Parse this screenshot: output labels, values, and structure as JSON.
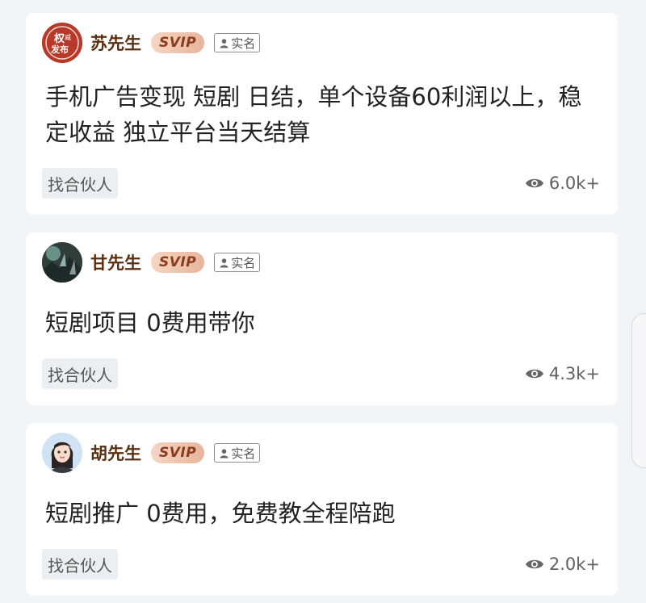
{
  "posts": [
    {
      "author": "苏先生",
      "badge": "SVIP",
      "verified": "实名",
      "avatar_icon": "official-release-seal-icon",
      "avatar_text": "权威发布",
      "title": "手机广告变现 短剧 日结，单个设备60利润以上，稳定收益 独立平台当天结算",
      "tag": "找合伙人",
      "views": "6.0k+"
    },
    {
      "author": "甘先生",
      "badge": "SVIP",
      "verified": "实名",
      "avatar_icon": "landscape-photo-avatar-icon",
      "title": "短剧项目 0费用带你",
      "tag": "找合伙人",
      "views": "4.3k+"
    },
    {
      "author": "胡先生",
      "badge": "SVIP",
      "verified": "实名",
      "avatar_icon": "cartoon-woman-avatar-icon",
      "title": "短剧推广 0费用，免费教全程陪跑",
      "tag": "找合伙人",
      "views": "2.0k+"
    }
  ],
  "colors": {
    "page_background": "#f3f4f8",
    "card_background": "#ffffff",
    "author_name": "#5a2f10",
    "svip_badge": "#e8b49a",
    "tag_background": "#eceef2"
  }
}
